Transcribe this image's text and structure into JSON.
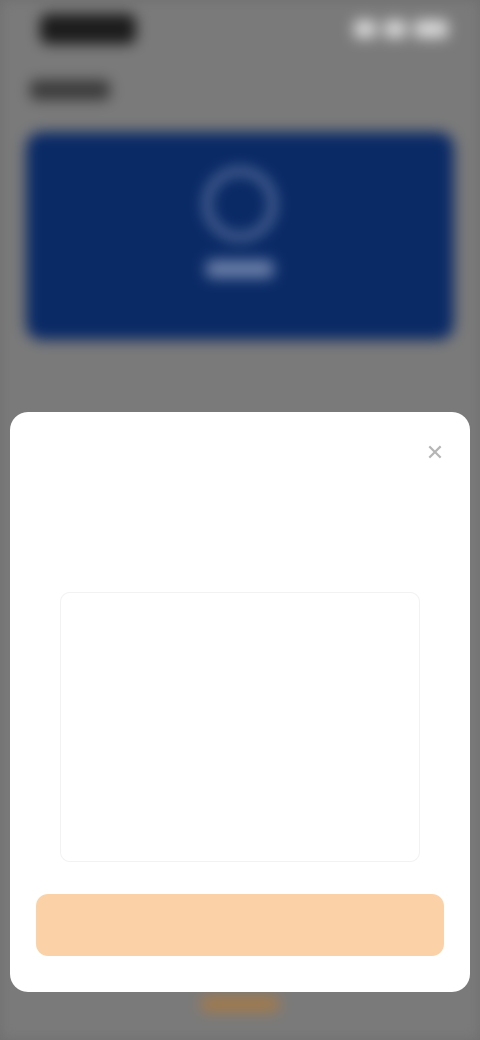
{
  "status_bar": {
    "time": "",
    "icons": [
      "signal-icon",
      "wifi-icon",
      "battery-icon"
    ]
  },
  "background": {
    "header_text": "",
    "card_label": ""
  },
  "modal": {
    "title": "",
    "close_label": "✕",
    "section_label": "",
    "hint": "",
    "textarea": {
      "value": "",
      "placeholder": ""
    },
    "submit_label": ""
  },
  "colors": {
    "card_bg": "#0a2a66",
    "submit_bg": "#fbd2a8",
    "overlay": "#7a7a7a"
  }
}
